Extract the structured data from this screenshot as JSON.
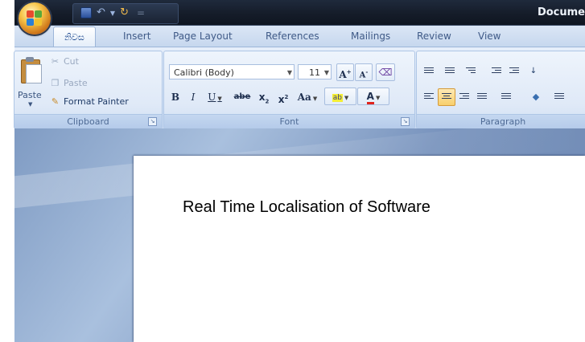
{
  "window": {
    "document_title": "Docume"
  },
  "quick_access": {
    "separator": "="
  },
  "tabs": [
    {
      "label": "නිවස",
      "active": true
    },
    {
      "label": "Insert"
    },
    {
      "label": "Page Layout"
    },
    {
      "label": "References"
    },
    {
      "label": "Mailings"
    },
    {
      "label": "Review"
    },
    {
      "label": "View"
    }
  ],
  "clipboard": {
    "paste_label": "Paste",
    "cut_label": "Cut",
    "copy_label": "Paste",
    "format_painter_label": "Format Painter",
    "group_label": "Clipboard"
  },
  "font": {
    "font_name": "Calibri (Body)",
    "font_size": "11",
    "grow": "A",
    "shrink": "A",
    "bold": "B",
    "italic": "I",
    "underline": "U",
    "strike": "abe",
    "subscript": "x",
    "superscript": "x",
    "change_case": "Aa",
    "highlight": "ab",
    "font_color": "A",
    "group_label": "Font"
  },
  "paragraph": {
    "group_label": "Paragraph"
  },
  "document": {
    "body_text": "Real Time Localisation of Software"
  },
  "colors": {
    "accent": "#15428b",
    "ribbon": "#dbe6f5",
    "highlight": "#f8cf6c",
    "font_red": "#e0231c"
  }
}
